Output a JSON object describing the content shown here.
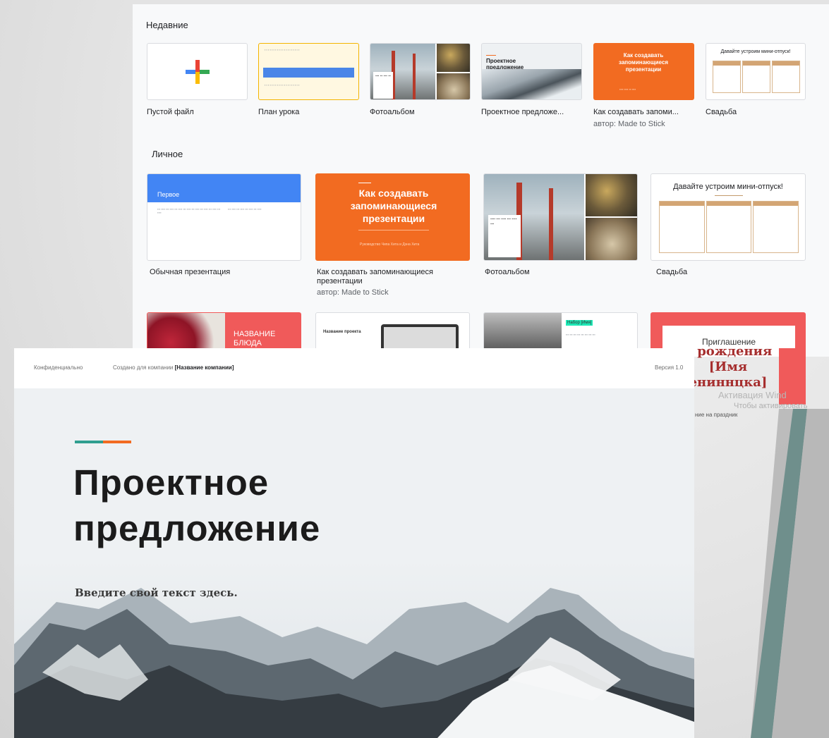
{
  "recent": {
    "title": "Недавние",
    "cards": [
      {
        "label": "Пустой файл"
      },
      {
        "label": "План урока"
      },
      {
        "label": "Фотоальбом"
      },
      {
        "label": "Проектное предложе...",
        "thumb_title": "Проектное предложение"
      },
      {
        "label": "Как создавать запоми...",
        "sub": "автор: Made to Stick",
        "thumb_title": "Как создавать запоминающиеся презентации"
      },
      {
        "label": "Свадьба",
        "thumb_title": "Давайте устроим мини-отпуск!"
      }
    ]
  },
  "personal": {
    "title": "Личное",
    "cards": [
      {
        "label": "Обычная презентация",
        "thumb_title": "Первое"
      },
      {
        "label": "Как создавать запоминающиеся презентации",
        "sub": "автор: Made to Stick",
        "thumb_title": "Как создавать запоминающиеся презентации",
        "thumb_sub": "Руководство Чипа Хита и Дэна Хита"
      },
      {
        "label": "Фотоальбом"
      },
      {
        "label": "Свадьба",
        "thumb_title": "Давайте устроим мини-отпуск!"
      }
    ]
  },
  "row3": {
    "food_title": "НАЗВАНИЕ БЛЮДА",
    "project_title": "Название проекта",
    "portfolio_title": "Набор [Имя]",
    "invite_title": "Приглашение"
  },
  "slide": {
    "header_left": "Конфиденциально",
    "header_mid_prefix": "Создано для компании ",
    "header_mid_bold": "[Название компании]",
    "header_right": "Версия 1.0",
    "title_line1": "Проектное",
    "title_line2": "предложение",
    "subtitle": "Введите свой текст здесь."
  },
  "overflow_invite": {
    "line1": "ь рождения",
    "line2": "[Имя",
    "line3": "ениннцка]"
  },
  "watermark": {
    "line1": "Активация Wind",
    "line2": "Чтобы активировать",
    "line3": "ние на праздник"
  },
  "colors": {
    "orange": "#f26b21",
    "blue": "#4285f4",
    "red": "#f05a5a",
    "teal": "#2f9e8f"
  }
}
